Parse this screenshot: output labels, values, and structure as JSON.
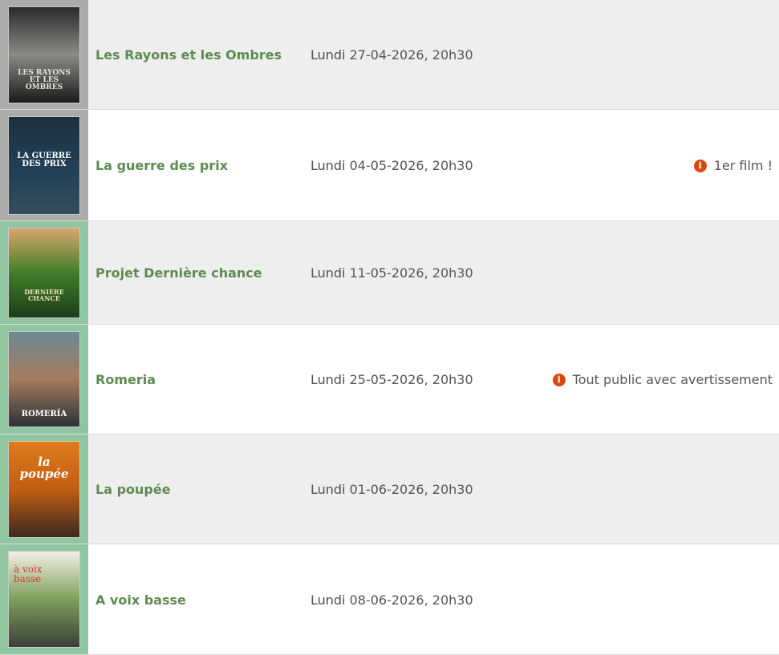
{
  "films": [
    {
      "title": "Les Rayons et les Ombres",
      "date": "Lundi 27-04-2026, 20h30",
      "note": "",
      "poster_text": "LES RAYONS ET LES OMBRES",
      "poster_colors": [
        "#2b2a28",
        "#8a8c88",
        "#1a1a19"
      ],
      "cell_color": "grey"
    },
    {
      "title": "La guerre des prix",
      "date": "Lundi 04-05-2026, 20h30",
      "note": "1er film !",
      "poster_text": "LA GUERRE DES PRIX",
      "poster_colors": [
        "#1f2f3f",
        "#203f56",
        "#344d5c"
      ],
      "cell_color": "grey"
    },
    {
      "title": "Projet Dernière chance",
      "date": "Lundi 11-05-2026, 20h30",
      "note": "",
      "poster_text": "DERNIÈRE CHANCE",
      "poster_colors": [
        "#d9a46a",
        "#3f7f2a",
        "#1f3d1a"
      ],
      "cell_color": "green"
    },
    {
      "title": "Romeria",
      "date": "Lundi 25-05-2026, 20h30",
      "note": "Tout public avec avertissement",
      "poster_text": "ROMERÍA",
      "poster_colors": [
        "#6b8a92",
        "#a67a5d",
        "#2c3338"
      ],
      "cell_color": "green"
    },
    {
      "title": "La poupée",
      "date": "Lundi 01-06-2026, 20h30",
      "note": "",
      "poster_text": "la poupée",
      "poster_colors": [
        "#e07a1b",
        "#c25e12",
        "#3b2a20"
      ],
      "cell_color": "green"
    },
    {
      "title": "A voix basse",
      "date": "Lundi 08-06-2026, 20h30",
      "note": "",
      "poster_text": "à voix basse",
      "poster_colors": [
        "#f4efe6",
        "#7da05a",
        "#3b3f3a"
      ],
      "cell_color": "green"
    }
  ],
  "icons": {
    "info": "info-icon"
  },
  "colors": {
    "title": "#5f8a51",
    "info": "#d9480f"
  }
}
